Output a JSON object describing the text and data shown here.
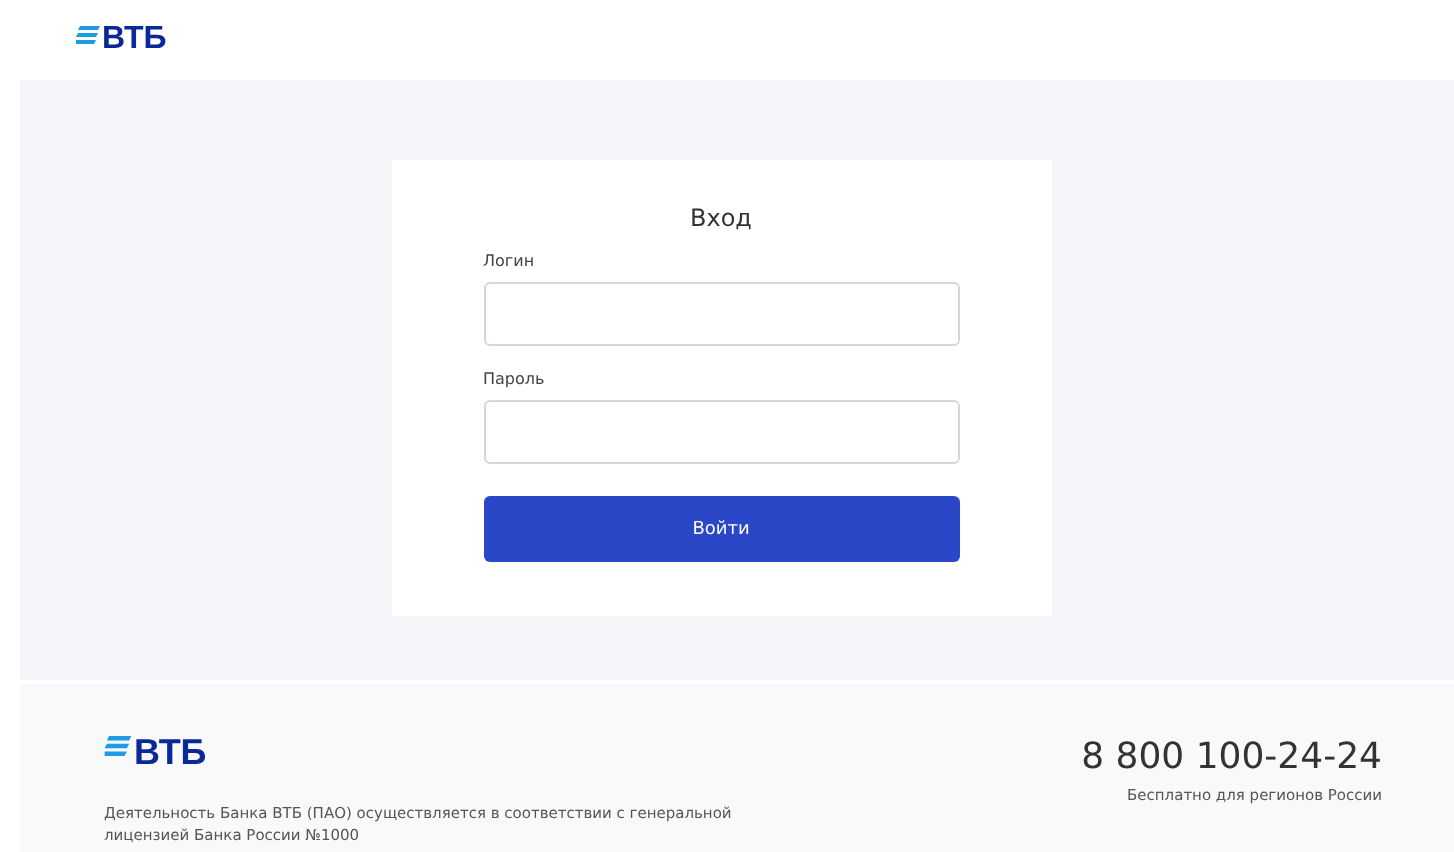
{
  "header": {
    "logo": "ВТБ"
  },
  "login_form": {
    "title": "Вход",
    "fields": [
      {
        "label": "Логин"
      },
      {
        "label": "Пароль"
      }
    ],
    "submit": "Войти"
  },
  "footer": {
    "logo": "ВТБ",
    "license": "Деятельность Банка ВТБ (ПАО) осуществляется в соответствии с генеральной лицензией Банка России №1000",
    "phone": "8 800 100-24-24",
    "phone_note": "Бесплатно для регионов России"
  }
}
